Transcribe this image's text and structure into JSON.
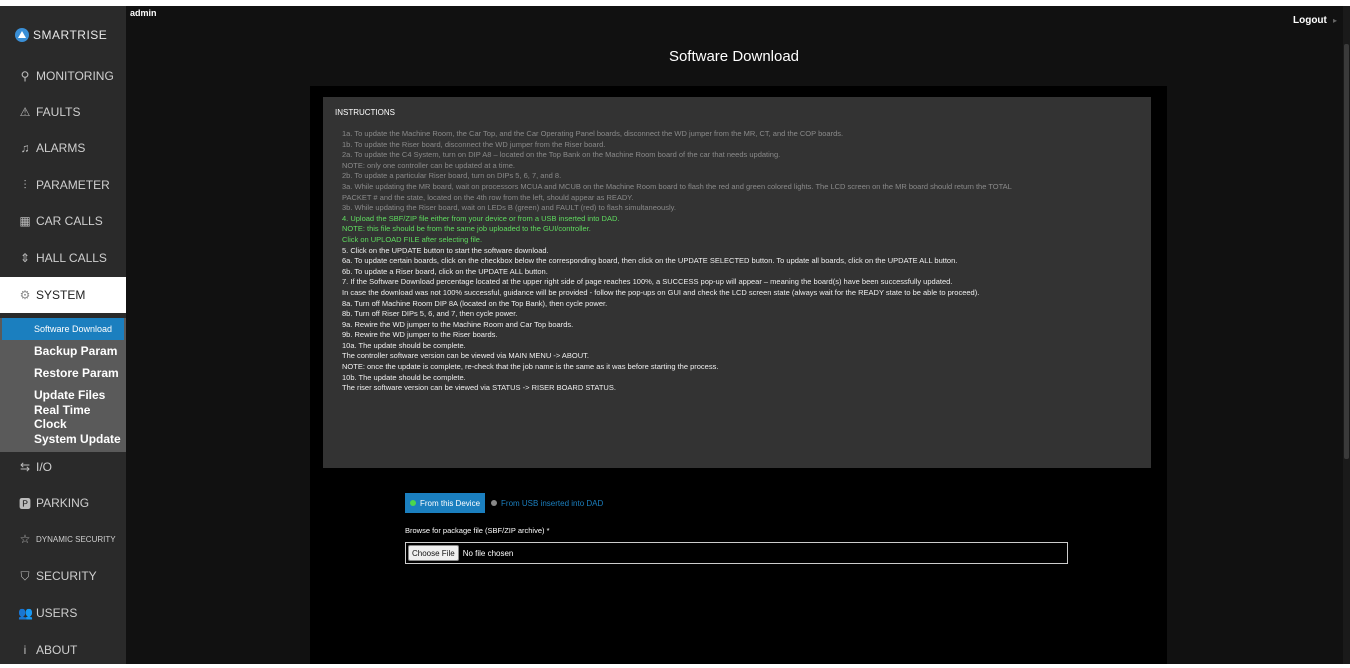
{
  "app": {
    "brand": "SMARTRISE",
    "user": "admin",
    "logout_label": "Logout"
  },
  "sidebar": {
    "items": [
      {
        "label": "MONITORING",
        "icon": "search-icon",
        "glyph": "⚲"
      },
      {
        "label": "FAULTS",
        "icon": "warning-icon",
        "glyph": "⚠"
      },
      {
        "label": "ALARMS",
        "icon": "bell-icon",
        "glyph": "♫"
      },
      {
        "label": "PARAMETER",
        "icon": "sliders-icon",
        "glyph": "⫶"
      },
      {
        "label": "CAR CALLS",
        "icon": "elevator-panel-icon",
        "glyph": "▦"
      },
      {
        "label": "HALL CALLS",
        "icon": "up-down-icon",
        "glyph": "⇕"
      },
      {
        "label": "SYSTEM",
        "icon": "gear-icon",
        "glyph": "⚙"
      },
      {
        "label": "I/O",
        "icon": "swap-icon",
        "glyph": "⇆"
      },
      {
        "label": "PARKING",
        "icon": "parking-icon",
        "glyph": "🅿"
      },
      {
        "label": "DYNAMIC SECURITY",
        "icon": "star-icon",
        "glyph": "☆"
      },
      {
        "label": "SECURITY",
        "icon": "shield-icon",
        "glyph": "⛉"
      },
      {
        "label": "USERS",
        "icon": "users-icon",
        "glyph": "👥"
      },
      {
        "label": "ABOUT",
        "icon": "info-icon",
        "glyph": "i"
      }
    ],
    "system_submenu": [
      "Software Download",
      "Backup Param",
      "Restore Param",
      "Update Files",
      "Real Time Clock",
      "System Update"
    ]
  },
  "main": {
    "title": "Software Download",
    "instructions_heading": "INSTRUCTIONS",
    "instructions": [
      {
        "text": "1a. To update the Machine Room, the Car Top, and the Car Operating Panel boards, disconnect the WD jumper from the MR, CT, and the COP boards.",
        "style": "dim"
      },
      {
        "text": "1b. To update the Riser board, disconnect the WD jumper from the Riser board.",
        "style": "dim"
      },
      {
        "text": "2a. To update the C4 System, turn on DIP A8 – located on the Top Bank on the Machine Room board of the car that needs updating.",
        "style": "dim"
      },
      {
        "text": "NOTE: only one controller can be updated at a time.",
        "style": "dim"
      },
      {
        "text": "2b. To update a particular Riser board, turn on DIPs 5, 6, 7, and 8.",
        "style": "dim"
      },
      {
        "text": "3a. While updating the MR board, wait on processors MCUA and MCUB on the Machine Room board to flash the red and green colored lights. The LCD screen on the MR board should return the TOTAL",
        "style": "dim"
      },
      {
        "text": "PACKET # and the state, located on the 4th row from the left, should appear as READY.",
        "style": "dim"
      },
      {
        "text": "3b. While updating the Riser board, wait on LEDs B (green) and FAULT (red) to flash simultaneously.",
        "style": "dim"
      },
      {
        "text": "4. Upload the SBF/ZIP file either from your device or from a USB inserted into DAD.",
        "style": "green"
      },
      {
        "text": "NOTE: this file should be from the same job uploaded to the GUI/controller.",
        "style": "green"
      },
      {
        "text": "Click on UPLOAD FILE after selecting file.",
        "style": "green"
      },
      {
        "text": "5. Click on the UPDATE button to start the software download.",
        "style": "white"
      },
      {
        "text": "6a. To update certain boards, click on the checkbox below the corresponding board, then click on the UPDATE SELECTED button. To update all boards, click on the UPDATE ALL button.",
        "style": "white"
      },
      {
        "text": "6b. To update a Riser board, click on the UPDATE ALL button.",
        "style": "white"
      },
      {
        "text": "7. If the Software Download percentage located at the upper right side of page reaches 100%, a SUCCESS pop-up will appear – meaning the board(s) have been successfully updated.",
        "style": "white"
      },
      {
        "text": "In case the download was not 100% successful, guidance will be provided - follow the pop-ups on GUI and check the LCD screen state (always wait for the READY state to be able to proceed).",
        "style": "white"
      },
      {
        "text": "8a. Turn off Machine Room DIP 8A (located on the Top Bank), then cycle power.",
        "style": "white"
      },
      {
        "text": "8b. Turn off Riser DIPs 5, 6, and 7, then cycle power.",
        "style": "white"
      },
      {
        "text": "9a. Rewire the WD jumper to the Machine Room and Car Top boards.",
        "style": "white"
      },
      {
        "text": "9b. Rewire the WD jumper to the Riser boards.",
        "style": "white"
      },
      {
        "text": "10a. The update should be complete.",
        "style": "white"
      },
      {
        "text": "The controller software version can be viewed via MAIN MENU -> ABOUT.",
        "style": "white"
      },
      {
        "text": "NOTE: once the update is complete, re-check that the job name is the same as it was before starting the process.",
        "style": "white"
      },
      {
        "text": "10b. The update should be complete.",
        "style": "white"
      },
      {
        "text": "The riser software version can be viewed via STATUS -> RISER BOARD STATUS.",
        "style": "white"
      }
    ],
    "source_device_label": "From this Device",
    "source_usb_label": "From USB inserted into DAD",
    "file_label": "Browse for package file (SBF/ZIP archive) *",
    "choose_file_label": "Choose File",
    "file_status": "No file chosen",
    "colors": {
      "accent": "#1b7fbf",
      "green": "#5fdc5f",
      "sidebar": "#2a2a2a"
    }
  }
}
